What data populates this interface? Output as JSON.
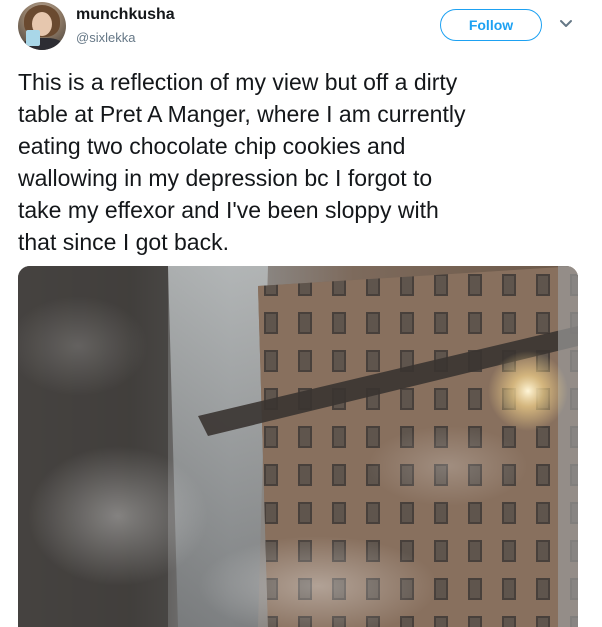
{
  "tweet": {
    "user": {
      "display_name": "munchkusha",
      "handle": "@sixlekka",
      "avatar_icon": "avatar-photo"
    },
    "follow_label": "Follow",
    "menu_icon": "chevron-down-icon",
    "text": "This is a reflection of my view but off a dirty\ntable at Pret A Manger, where I am currently\neating two chocolate chip cookies and\nwallowing in my depression bc I forgot to\ntake my effexor and I've been sloppy with\nthat since I got back.",
    "accent_color": "#1da1f2",
    "muted_color": "#657786"
  }
}
